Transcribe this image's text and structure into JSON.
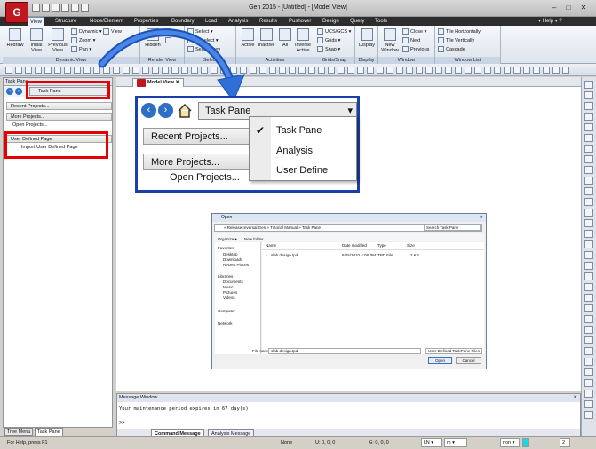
{
  "window": {
    "title": "Gen 2015 - [Untitled] - [Model View]",
    "app_logo": "G"
  },
  "menu": {
    "tabs": [
      "View",
      "Structure",
      "Node/Element",
      "Properties",
      "Boundary",
      "Load",
      "Analysis",
      "Results",
      "Pushover",
      "Design",
      "Query",
      "Tools"
    ],
    "active": "View",
    "help": "Help"
  },
  "ribbon": {
    "dynamic_view": {
      "label": "Dynamic View",
      "buttons": [
        "Redraw",
        "Initial View",
        "Previous View"
      ],
      "small": [
        "Dynamic",
        "Zoom",
        "Pan"
      ],
      "extra": "View"
    },
    "render_view": {
      "label": "Render View",
      "buttons": [
        "Hidden"
      ]
    },
    "select": {
      "label": "Select",
      "small": [
        "Select",
        "Unselect",
        "Select Prev"
      ]
    },
    "activities": {
      "label": "Activities",
      "buttons": [
        "Active",
        "Inactive",
        "All",
        "Inverse Active"
      ]
    },
    "grids_snap": {
      "label": "Grids/Snap",
      "small": [
        "UCS/GCS",
        "Grids",
        "Snap"
      ]
    },
    "display": {
      "label": "Display",
      "buttons": [
        "Display"
      ]
    },
    "window": {
      "label": "Window",
      "buttons": [
        "New Window"
      ],
      "small": [
        "Close",
        "Next",
        "Previous"
      ]
    },
    "window_list": {
      "label": "Window List",
      "small": [
        "Tile Horizontally",
        "Tile Vertically",
        "Cascade"
      ]
    }
  },
  "task_pane": {
    "title": "Task Pane",
    "combo": "Task Pane",
    "sections": [
      {
        "label": "Recent Projects...",
        "items": []
      },
      {
        "label": "More Projects...",
        "items": [
          "Open Projects..."
        ]
      },
      {
        "label": "User Defined Page",
        "items": [
          "Import User Defined Page"
        ]
      }
    ],
    "bottom_tabs": [
      "Tree Menu",
      "Task Pane"
    ]
  },
  "model_view": {
    "tab_label": "Model View"
  },
  "zoom_callout": {
    "combo": "Task Pane",
    "sections": [
      "Recent Projects...",
      "More Projects..."
    ],
    "item": "Open Projects...",
    "dropdown": [
      "Task Pane",
      "Analysis",
      "User Define"
    ],
    "checked": "Task Pane"
  },
  "open_dialog": {
    "title": "Open",
    "address": "« Release reversal Gen » Tutorial Manual » Task Pane",
    "search": "Search Task Pane",
    "organize": "Organize ▾",
    "new_folder": "New folder",
    "nav": [
      "Favorites",
      "Desktop",
      "Downloads",
      "Recent Places",
      "Libraries",
      "Documents",
      "Music",
      "Pictures",
      "Videos",
      "Computer",
      "Network"
    ],
    "columns": [
      "Name",
      "Date modified",
      "Type",
      "Size"
    ],
    "files": [
      {
        "name": "slab design.tpd",
        "date": "8/25/2010 4:08 PM",
        "type": "TPD File",
        "size": "2 KB"
      }
    ],
    "file_name_label": "File name:",
    "file_name": "slab design.tpd",
    "file_type": "User Defined TaskPane Files (*.t",
    "open_btn": "Open",
    "cancel_btn": "Cancel"
  },
  "message_window": {
    "title": "Message Window",
    "text": "Your maintenance period expires in 67 day(s).",
    "prompt": ">>",
    "tabs": [
      "Command Message",
      "Analysis Message"
    ]
  },
  "status": {
    "help": "For Help, press F1",
    "none": "None",
    "u": "U: 0, 0, 0",
    "g": "G: 0, 0, 0",
    "force_unit": "kN",
    "length_unit": "m",
    "none2": "non",
    "page": "2"
  },
  "colors": {
    "highlight_red": "#e60000",
    "callout_blue": "#1a3fa8",
    "brand_red": "#c0181e"
  }
}
